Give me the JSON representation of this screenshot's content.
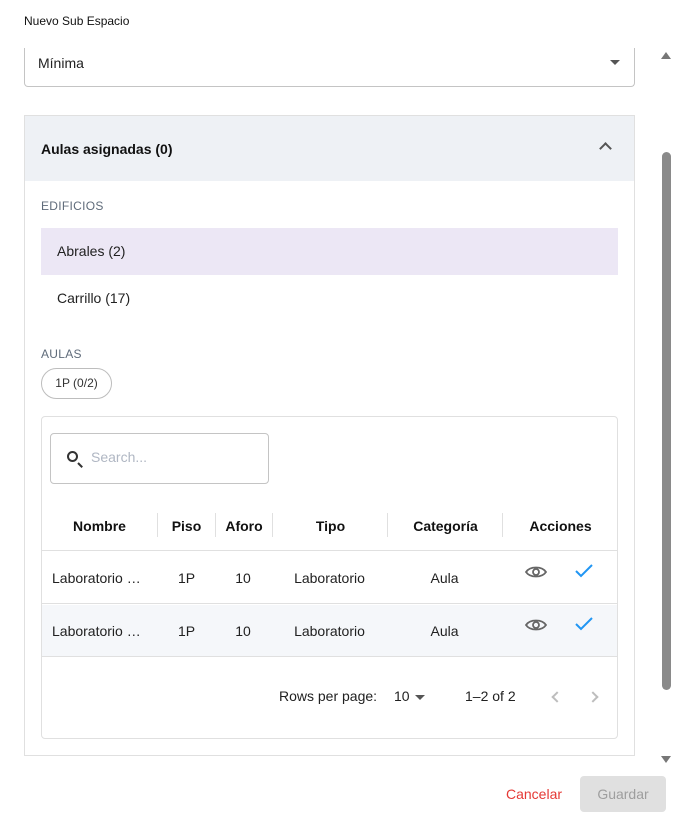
{
  "dialog": {
    "title": "Nuevo Sub Espacio"
  },
  "select": {
    "value": "Mínima"
  },
  "accordion": {
    "title": "Aulas asignadas (0)"
  },
  "buildings": {
    "label": "EDIFICIOS",
    "items": [
      {
        "label": "Abrales (2)",
        "selected": true
      },
      {
        "label": "Carrillo (17)",
        "selected": false
      }
    ]
  },
  "aulas": {
    "label": "AULAS",
    "chip": "1P (0/2)"
  },
  "table": {
    "search_placeholder": "Search...",
    "columns": [
      "Nombre",
      "Piso",
      "Aforo",
      "Tipo",
      "Categoría",
      "Acciones"
    ],
    "rows": [
      {
        "nombre": "Laboratorio …",
        "piso": "1P",
        "aforo": "10",
        "tipo": "Laboratorio",
        "categoria": "Aula"
      },
      {
        "nombre": "Laboratorio …",
        "piso": "1P",
        "aforo": "10",
        "tipo": "Laboratorio",
        "categoria": "Aula"
      }
    ],
    "pagination": {
      "rows_per_page_label": "Rows per page:",
      "rows_per_page": "10",
      "range": "1–2 of 2"
    }
  },
  "icons": {
    "search": "search-icon",
    "view": "eye-icon",
    "select": "check-icon",
    "expand": "chevron-up-icon"
  },
  "colors": {
    "selected_bg": "#ece7f5",
    "header_bg": "#eef1f5",
    "check": "#2196f3",
    "cancel": "#e53935"
  },
  "actions": {
    "cancel": "Cancelar",
    "save": "Guardar"
  }
}
